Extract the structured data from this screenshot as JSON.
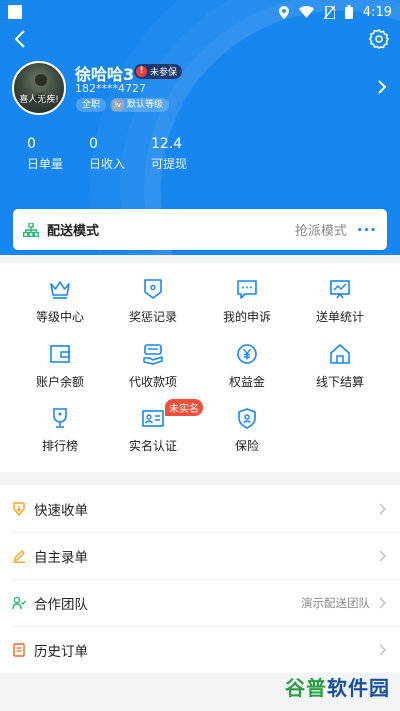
{
  "status_bar": {
    "time": "4:19"
  },
  "profile": {
    "name": "徐哈哈3",
    "insurance_badge": "未参保",
    "insurance_mark": "!",
    "phone": "182****4727",
    "tag_fulltime": "全职",
    "level_icon_text": "lv",
    "tag_level": "默认等级",
    "avatar_caption": "喜人无疾!"
  },
  "stats": [
    {
      "value": "0",
      "label": "日单量"
    },
    {
      "value": "0",
      "label": "日收入"
    },
    {
      "value": "12.4",
      "label": "可提现"
    }
  ],
  "delivery_mode": {
    "title": "配送模式",
    "value": "抢派模式",
    "more": "···"
  },
  "grid": [
    {
      "label": "等级中心",
      "icon": "crown-icon"
    },
    {
      "label": "奖惩记录",
      "icon": "shield-badge-icon"
    },
    {
      "label": "我的申诉",
      "icon": "message-icon"
    },
    {
      "label": "送单统计",
      "icon": "chart-icon"
    },
    {
      "label": "账户余额",
      "icon": "wallet-icon"
    },
    {
      "label": "代收款项",
      "icon": "collection-icon"
    },
    {
      "label": "权益金",
      "icon": "yen-coin-icon"
    },
    {
      "label": "线下结算",
      "icon": "house-icon"
    },
    {
      "label": "排行榜",
      "icon": "trophy-icon"
    },
    {
      "label": "实名认证",
      "icon": "id-card-icon",
      "badge": "未实名"
    },
    {
      "label": "保险",
      "icon": "insurance-shield-icon"
    }
  ],
  "menu": [
    {
      "label": "快速收单",
      "icon": "quick-receive-icon",
      "color": "#f5a623"
    },
    {
      "label": "自主录单",
      "icon": "pencil-icon",
      "color": "#f5a623"
    },
    {
      "label": "合作团队",
      "icon": "team-icon",
      "color": "#2bb673",
      "value": "演示配送团队"
    },
    {
      "label": "历史订单",
      "icon": "history-order-icon",
      "color": "#f26522"
    }
  ],
  "watermark": {
    "part1": "谷普",
    "part2": "软件园"
  },
  "colors": {
    "brand_blue": "#1787ef",
    "badge_red": "#f24f3a",
    "dark_badge": "#1b3b6e"
  }
}
